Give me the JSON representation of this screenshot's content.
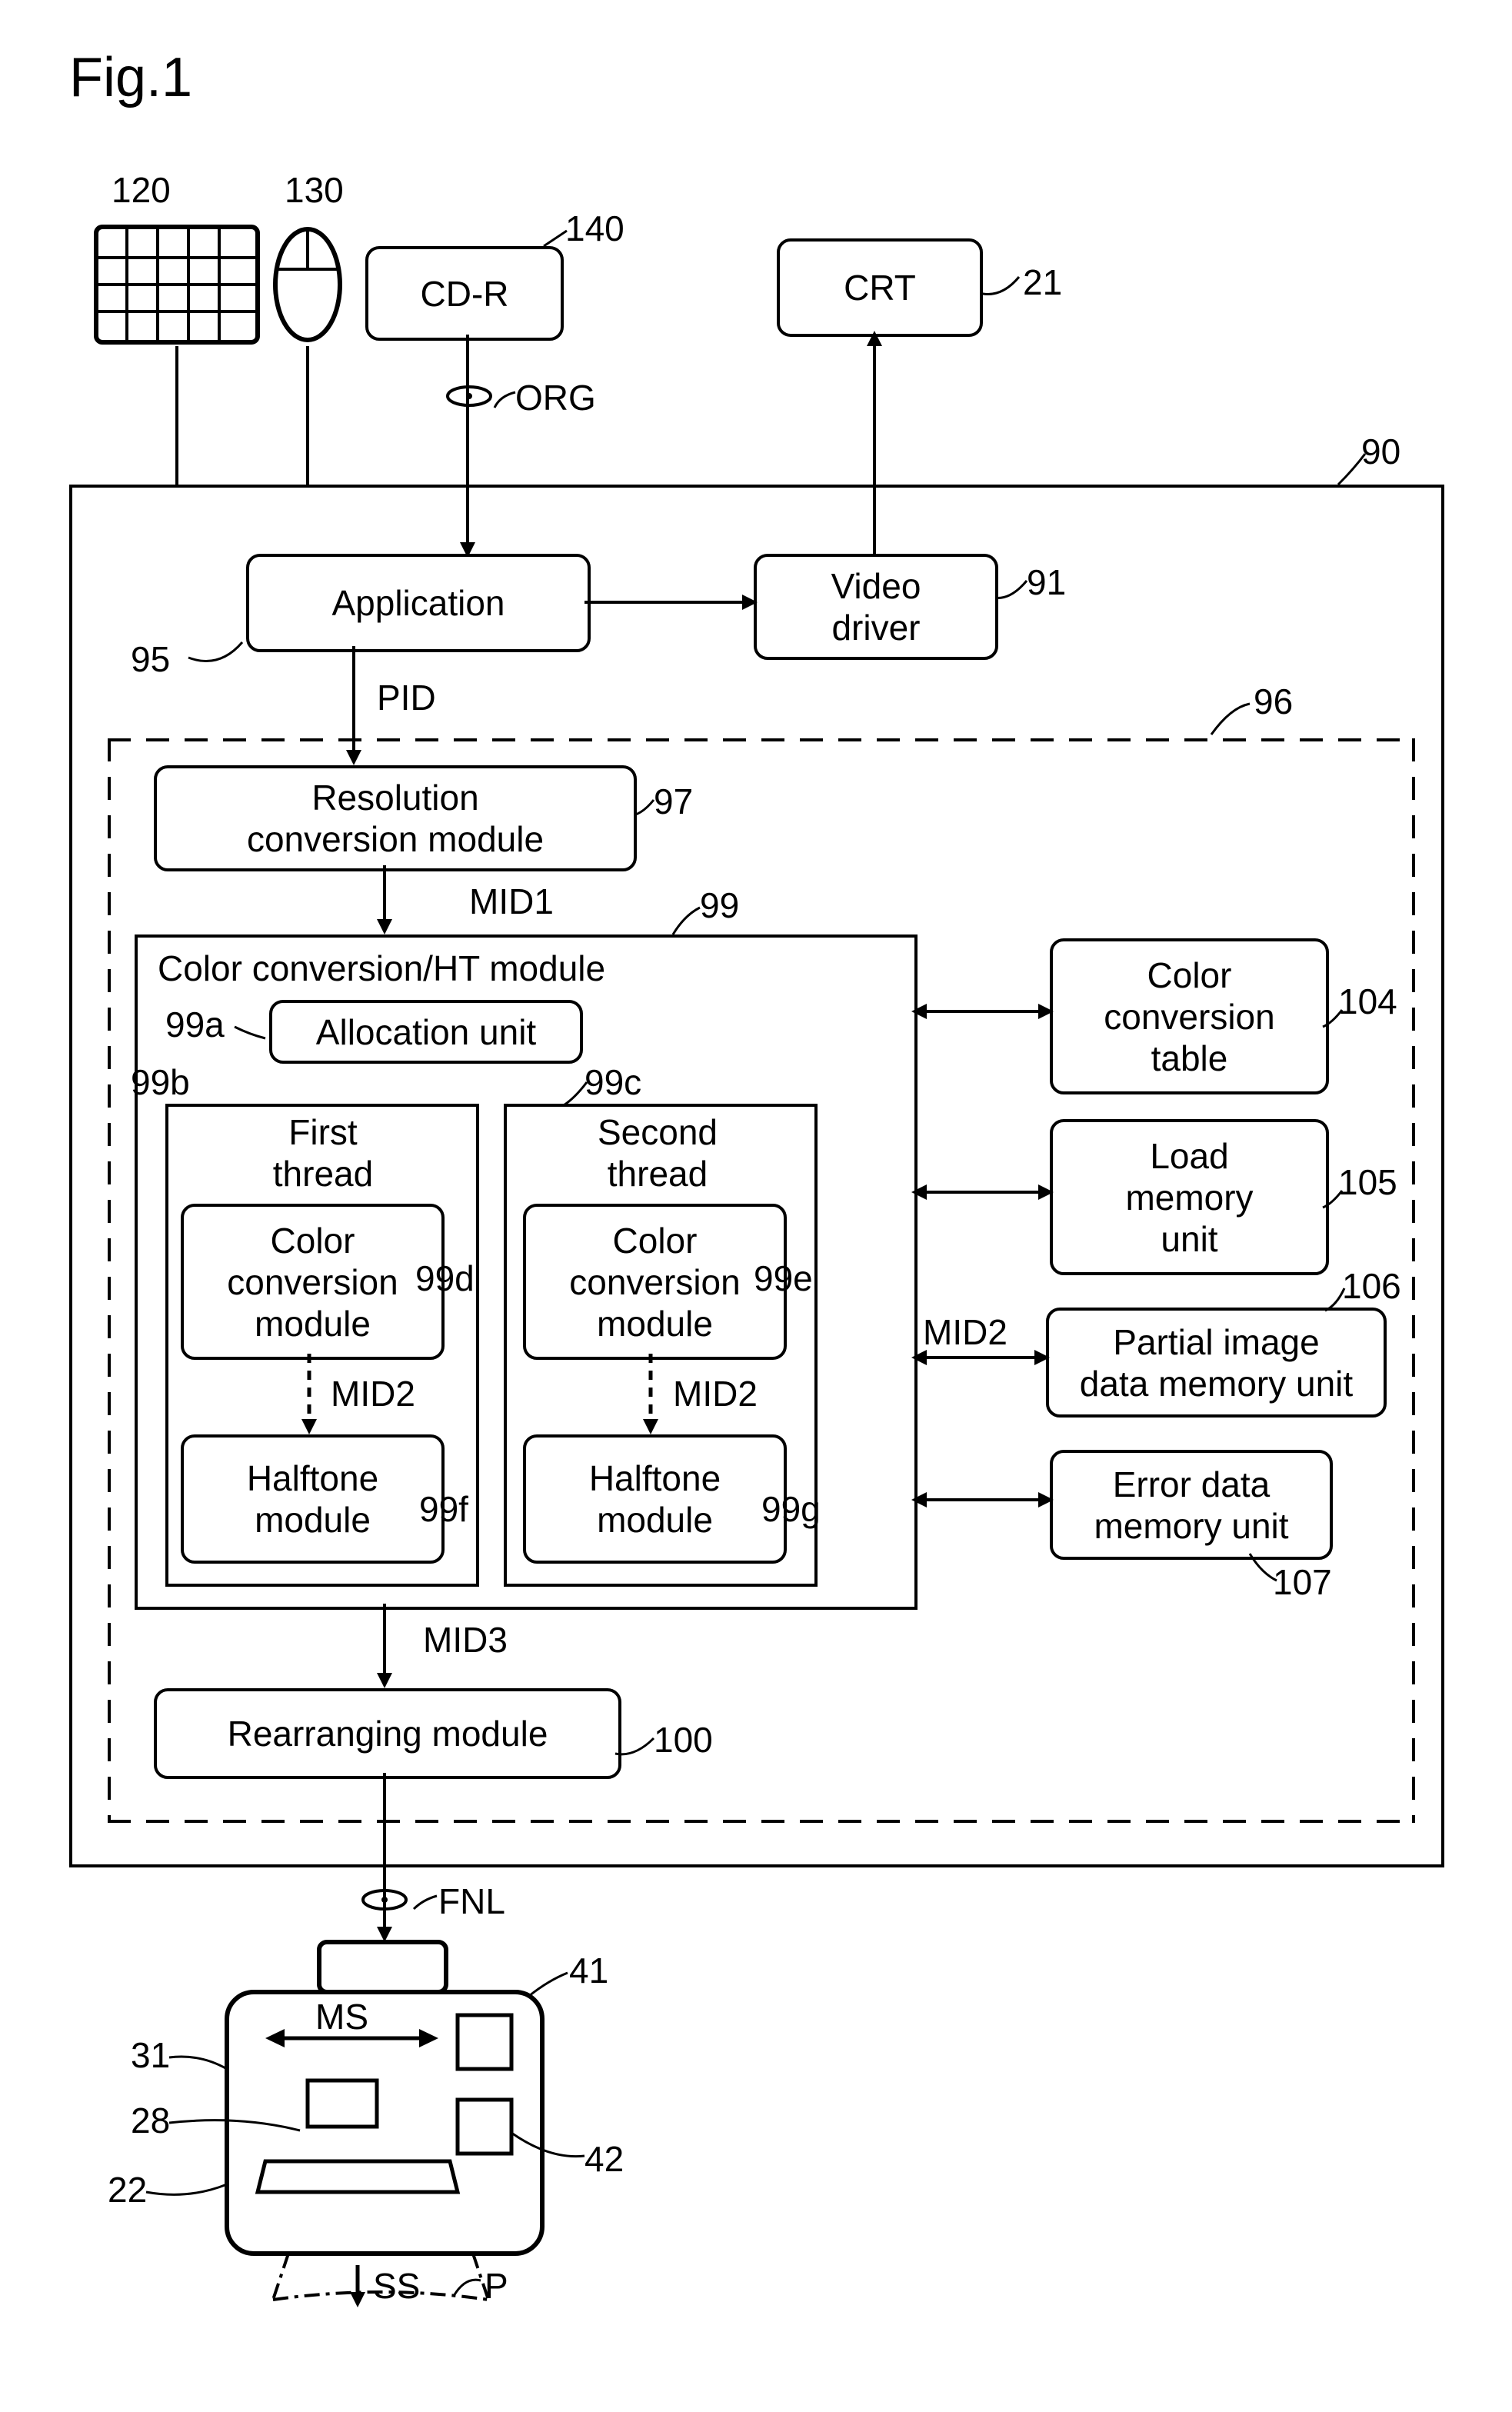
{
  "figure_title": "Fig.1",
  "labels": {
    "ref_120": "120",
    "ref_130": "130",
    "ref_140": "140",
    "ref_21": "21",
    "ref_90": "90",
    "ref_91": "91",
    "ref_95": "95",
    "ref_96": "96",
    "ref_97": "97",
    "ref_99": "99",
    "ref_99a": "99a",
    "ref_99b": "99b",
    "ref_99c": "99c",
    "ref_99d": "99d",
    "ref_99e": "99e",
    "ref_99f": "99f",
    "ref_99g": "99g",
    "ref_100": "100",
    "ref_104": "104",
    "ref_105": "105",
    "ref_106": "106",
    "ref_107": "107",
    "ref_41": "41",
    "ref_42": "42",
    "ref_31": "31",
    "ref_28": "28",
    "ref_22": "22"
  },
  "blocks": {
    "cdr": "CD-R",
    "crt": "CRT",
    "application": "Application",
    "video_driver": "Video\ndriver",
    "resolution": "Resolution\nconversion module",
    "color_ht": "Color conversion/HT module",
    "allocation": "Allocation unit",
    "first_thread": "First\nthread",
    "second_thread": "Second\nthread",
    "color_conv_1": "Color\nconversion\nmodule",
    "color_conv_2": "Color\nconversion\nmodule",
    "halftone_1": "Halftone\nmodule",
    "halftone_2": "Halftone\nmodule",
    "rearranging": "Rearranging module",
    "color_table": "Color\nconversion\ntable",
    "load_memory": "Load\nmemory\nunit",
    "partial_image": "Partial image\ndata memory unit",
    "error_data": "Error data\nmemory unit"
  },
  "signals": {
    "org": "ORG",
    "pid": "PID",
    "mid1": "MID1",
    "mid2": "MID2",
    "mid2b": "MID2",
    "mid2c": "MID2",
    "mid3": "MID3",
    "fnl": "FNL",
    "ms": "MS",
    "ss": "SS",
    "p": "P"
  }
}
